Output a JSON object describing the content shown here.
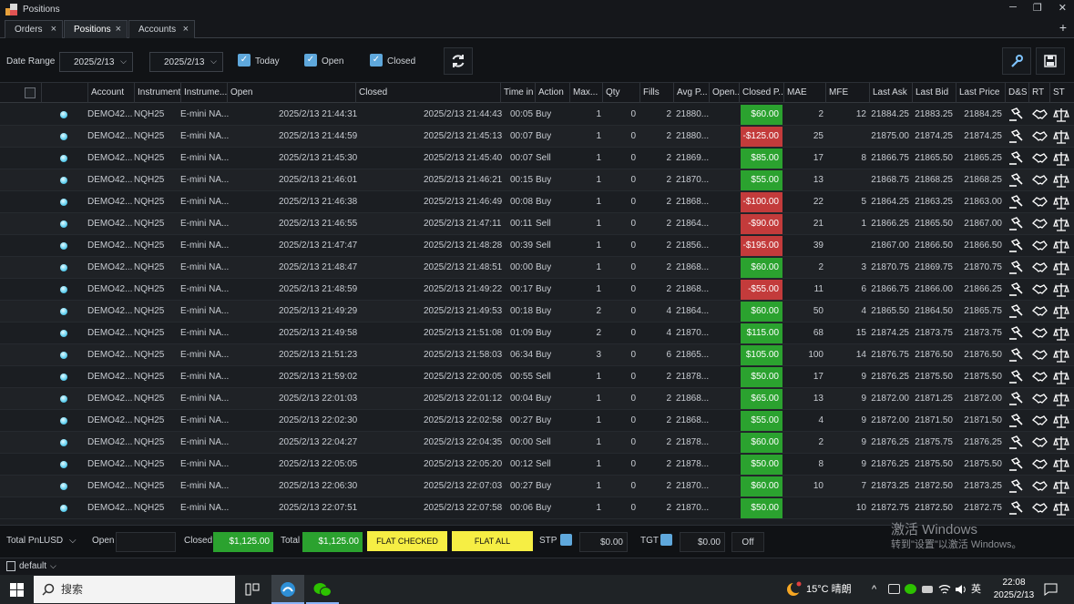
{
  "window": {
    "title": "Positions",
    "controls": {
      "minimize": "─",
      "restore": "❐",
      "close": "✕"
    }
  },
  "tabs": [
    {
      "label": "Orders"
    },
    {
      "label": "Positions"
    },
    {
      "label": "Accounts"
    }
  ],
  "tab_close": "×",
  "tab_add": "+",
  "toolbar": {
    "date_range_label": "Date Range",
    "date_from": "2025/2/13",
    "date_to": "2025/2/13",
    "today_label": "Today",
    "open_label": "Open",
    "closed_label": "Closed",
    "check_glyph": "✓",
    "caret": "⌵"
  },
  "columns": [
    "Account",
    "Instrument",
    "Instrume...",
    "Open",
    "Closed",
    "Time in",
    "Action",
    "Max...",
    "Qty",
    "Fills",
    "Avg P...",
    "Open...",
    "Closed P...",
    "MAE",
    "MFE",
    "Last Ask",
    "Last Bid",
    "Last Price",
    "D&S",
    "RT",
    "ST"
  ],
  "rows": [
    {
      "account": "DEMO42...",
      "instrument": "NQH25",
      "instrument_name": "E-mini NA...",
      "open": "2025/2/13 21:44:31",
      "closed": "2025/2/13 21:44:43",
      "time_in": "00:05",
      "action": "Buy",
      "max": "1",
      "qty": "0",
      "fills": "2",
      "avg_price": "21880...",
      "closed_pnl": "$60.00",
      "pnl_sign": "pos",
      "mae": "2",
      "mfe": "12",
      "last_ask": "21884.25",
      "last_bid": "21883.25",
      "last_price": "21884.25"
    },
    {
      "account": "DEMO42...",
      "instrument": "NQH25",
      "instrument_name": "E-mini NA...",
      "open": "2025/2/13 21:44:59",
      "closed": "2025/2/13 21:45:13",
      "time_in": "00:07",
      "action": "Buy",
      "max": "1",
      "qty": "0",
      "fills": "2",
      "avg_price": "21880...",
      "closed_pnl": "-$125.00",
      "pnl_sign": "neg",
      "mae": "25",
      "mfe": "",
      "last_ask": "21875.00",
      "last_bid": "21874.25",
      "last_price": "21874.25"
    },
    {
      "account": "DEMO42...",
      "instrument": "NQH25",
      "instrument_name": "E-mini NA...",
      "open": "2025/2/13 21:45:30",
      "closed": "2025/2/13 21:45:40",
      "time_in": "00:07",
      "action": "Sell",
      "max": "1",
      "qty": "0",
      "fills": "2",
      "avg_price": "21869...",
      "closed_pnl": "$85.00",
      "pnl_sign": "pos",
      "mae": "17",
      "mfe": "8",
      "last_ask": "21866.75",
      "last_bid": "21865.50",
      "last_price": "21865.25"
    },
    {
      "account": "DEMO42...",
      "instrument": "NQH25",
      "instrument_name": "E-mini NA...",
      "open": "2025/2/13 21:46:01",
      "closed": "2025/2/13 21:46:21",
      "time_in": "00:15",
      "action": "Buy",
      "max": "1",
      "qty": "0",
      "fills": "2",
      "avg_price": "21870...",
      "closed_pnl": "$55.00",
      "pnl_sign": "pos",
      "mae": "13",
      "mfe": "",
      "last_ask": "21868.75",
      "last_bid": "21868.25",
      "last_price": "21868.25"
    },
    {
      "account": "DEMO42...",
      "instrument": "NQH25",
      "instrument_name": "E-mini NA...",
      "open": "2025/2/13 21:46:38",
      "closed": "2025/2/13 21:46:49",
      "time_in": "00:08",
      "action": "Buy",
      "max": "1",
      "qty": "0",
      "fills": "2",
      "avg_price": "21868...",
      "closed_pnl": "-$100.00",
      "pnl_sign": "neg",
      "mae": "22",
      "mfe": "5",
      "last_ask": "21864.25",
      "last_bid": "21863.25",
      "last_price": "21863.00"
    },
    {
      "account": "DEMO42...",
      "instrument": "NQH25",
      "instrument_name": "E-mini NA...",
      "open": "2025/2/13 21:46:55",
      "closed": "2025/2/13 21:47:11",
      "time_in": "00:11",
      "action": "Sell",
      "max": "1",
      "qty": "0",
      "fills": "2",
      "avg_price": "21864...",
      "closed_pnl": "-$90.00",
      "pnl_sign": "neg",
      "mae": "21",
      "mfe": "1",
      "last_ask": "21866.25",
      "last_bid": "21865.50",
      "last_price": "21867.00"
    },
    {
      "account": "DEMO42...",
      "instrument": "NQH25",
      "instrument_name": "E-mini NA...",
      "open": "2025/2/13 21:47:47",
      "closed": "2025/2/13 21:48:28",
      "time_in": "00:39",
      "action": "Sell",
      "max": "1",
      "qty": "0",
      "fills": "2",
      "avg_price": "21856...",
      "closed_pnl": "-$195.00",
      "pnl_sign": "neg",
      "mae": "39",
      "mfe": "",
      "last_ask": "21867.00",
      "last_bid": "21866.50",
      "last_price": "21866.50"
    },
    {
      "account": "DEMO42...",
      "instrument": "NQH25",
      "instrument_name": "E-mini NA...",
      "open": "2025/2/13 21:48:47",
      "closed": "2025/2/13 21:48:51",
      "time_in": "00:00",
      "action": "Buy",
      "max": "1",
      "qty": "0",
      "fills": "2",
      "avg_price": "21868...",
      "closed_pnl": "$60.00",
      "pnl_sign": "pos",
      "mae": "2",
      "mfe": "3",
      "last_ask": "21870.75",
      "last_bid": "21869.75",
      "last_price": "21870.75"
    },
    {
      "account": "DEMO42...",
      "instrument": "NQH25",
      "instrument_name": "E-mini NA...",
      "open": "2025/2/13 21:48:59",
      "closed": "2025/2/13 21:49:22",
      "time_in": "00:17",
      "action": "Buy",
      "max": "1",
      "qty": "0",
      "fills": "2",
      "avg_price": "21868...",
      "closed_pnl": "-$55.00",
      "pnl_sign": "neg",
      "mae": "11",
      "mfe": "6",
      "last_ask": "21866.75",
      "last_bid": "21866.00",
      "last_price": "21866.25"
    },
    {
      "account": "DEMO42...",
      "instrument": "NQH25",
      "instrument_name": "E-mini NA...",
      "open": "2025/2/13 21:49:29",
      "closed": "2025/2/13 21:49:53",
      "time_in": "00:18",
      "action": "Buy",
      "max": "2",
      "qty": "0",
      "fills": "4",
      "avg_price": "21864...",
      "closed_pnl": "$60.00",
      "pnl_sign": "pos",
      "mae": "50",
      "mfe": "4",
      "last_ask": "21865.50",
      "last_bid": "21864.50",
      "last_price": "21865.75"
    },
    {
      "account": "DEMO42...",
      "instrument": "NQH25",
      "instrument_name": "E-mini NA...",
      "open": "2025/2/13 21:49:58",
      "closed": "2025/2/13 21:51:08",
      "time_in": "01:09",
      "action": "Buy",
      "max": "2",
      "qty": "0",
      "fills": "4",
      "avg_price": "21870...",
      "closed_pnl": "$115.00",
      "pnl_sign": "pos",
      "mae": "68",
      "mfe": "15",
      "last_ask": "21874.25",
      "last_bid": "21873.75",
      "last_price": "21873.75"
    },
    {
      "account": "DEMO42...",
      "instrument": "NQH25",
      "instrument_name": "E-mini NA...",
      "open": "2025/2/13 21:51:23",
      "closed": "2025/2/13 21:58:03",
      "time_in": "06:34",
      "action": "Buy",
      "max": "3",
      "qty": "0",
      "fills": "6",
      "avg_price": "21865...",
      "closed_pnl": "$105.00",
      "pnl_sign": "pos",
      "mae": "100",
      "mfe": "14",
      "last_ask": "21876.75",
      "last_bid": "21876.50",
      "last_price": "21876.50"
    },
    {
      "account": "DEMO42...",
      "instrument": "NQH25",
      "instrument_name": "E-mini NA...",
      "open": "2025/2/13 21:59:02",
      "closed": "2025/2/13 22:00:05",
      "time_in": "00:55",
      "action": "Sell",
      "max": "1",
      "qty": "0",
      "fills": "2",
      "avg_price": "21878...",
      "closed_pnl": "$50.00",
      "pnl_sign": "pos",
      "mae": "17",
      "mfe": "9",
      "last_ask": "21876.25",
      "last_bid": "21875.50",
      "last_price": "21875.50"
    },
    {
      "account": "DEMO42...",
      "instrument": "NQH25",
      "instrument_name": "E-mini NA...",
      "open": "2025/2/13 22:01:03",
      "closed": "2025/2/13 22:01:12",
      "time_in": "00:04",
      "action": "Buy",
      "max": "1",
      "qty": "0",
      "fills": "2",
      "avg_price": "21868...",
      "closed_pnl": "$65.00",
      "pnl_sign": "pos",
      "mae": "13",
      "mfe": "9",
      "last_ask": "21872.00",
      "last_bid": "21871.25",
      "last_price": "21872.00"
    },
    {
      "account": "DEMO42...",
      "instrument": "NQH25",
      "instrument_name": "E-mini NA...",
      "open": "2025/2/13 22:02:30",
      "closed": "2025/2/13 22:02:58",
      "time_in": "00:27",
      "action": "Buy",
      "max": "1",
      "qty": "0",
      "fills": "2",
      "avg_price": "21868...",
      "closed_pnl": "$55.00",
      "pnl_sign": "pos",
      "mae": "4",
      "mfe": "9",
      "last_ask": "21872.00",
      "last_bid": "21871.50",
      "last_price": "21871.50"
    },
    {
      "account": "DEMO42...",
      "instrument": "NQH25",
      "instrument_name": "E-mini NA...",
      "open": "2025/2/13 22:04:27",
      "closed": "2025/2/13 22:04:35",
      "time_in": "00:00",
      "action": "Sell",
      "max": "1",
      "qty": "0",
      "fills": "2",
      "avg_price": "21878...",
      "closed_pnl": "$60.00",
      "pnl_sign": "pos",
      "mae": "2",
      "mfe": "9",
      "last_ask": "21876.25",
      "last_bid": "21875.75",
      "last_price": "21876.25"
    },
    {
      "account": "DEMO42...",
      "instrument": "NQH25",
      "instrument_name": "E-mini NA...",
      "open": "2025/2/13 22:05:05",
      "closed": "2025/2/13 22:05:20",
      "time_in": "00:12",
      "action": "Sell",
      "max": "1",
      "qty": "0",
      "fills": "2",
      "avg_price": "21878...",
      "closed_pnl": "$50.00",
      "pnl_sign": "pos",
      "mae": "8",
      "mfe": "9",
      "last_ask": "21876.25",
      "last_bid": "21875.50",
      "last_price": "21875.50"
    },
    {
      "account": "DEMO42...",
      "instrument": "NQH25",
      "instrument_name": "E-mini NA...",
      "open": "2025/2/13 22:06:30",
      "closed": "2025/2/13 22:07:03",
      "time_in": "00:27",
      "action": "Buy",
      "max": "1",
      "qty": "0",
      "fills": "2",
      "avg_price": "21870...",
      "closed_pnl": "$60.00",
      "pnl_sign": "pos",
      "mae": "10",
      "mfe": "7",
      "last_ask": "21873.25",
      "last_bid": "21872.50",
      "last_price": "21873.25"
    },
    {
      "account": "DEMO42...",
      "instrument": "NQH25",
      "instrument_name": "E-mini NA...",
      "open": "2025/2/13 22:07:51",
      "closed": "2025/2/13 22:07:58",
      "time_in": "00:06",
      "action": "Buy",
      "max": "1",
      "qty": "0",
      "fills": "2",
      "avg_price": "21870...",
      "closed_pnl": "$50.00",
      "pnl_sign": "pos",
      "mae": "",
      "mfe": "10",
      "last_ask": "21872.75",
      "last_bid": "21872.50",
      "last_price": "21872.75"
    }
  ],
  "footer": {
    "total_pnl_label": "Total PnL",
    "currency": "USD",
    "currency_caret": "⌵",
    "open_label": "Open",
    "open_value": "",
    "closed_label": "Closed",
    "closed_value": "$1,125.00",
    "total_label": "Total",
    "total_value": "$1,125.00",
    "flat_checked": "FLAT CHECKED",
    "flat_all": "FLAT ALL",
    "stp_label": "STP",
    "stp_value": "$0.00",
    "tgt_label": "TGT",
    "tgt_value": "$0.00",
    "off_label": "Off"
  },
  "watermark": {
    "line1": "激活 Windows",
    "line2": "转到\"设置\"以激活 Windows。"
  },
  "statusbar": {
    "workspace": "default",
    "caret": "⌵"
  },
  "taskbar": {
    "search_placeholder": "搜索",
    "weather": "15°C 晴朗",
    "tray_chevron": "^",
    "ime": "英",
    "time": "22:08",
    "date": "2025/2/13"
  },
  "colors": {
    "profit": "#2ba22f",
    "loss": "#c33b3b",
    "accent": "#5fa8dc",
    "flat": "#f6ee44"
  }
}
